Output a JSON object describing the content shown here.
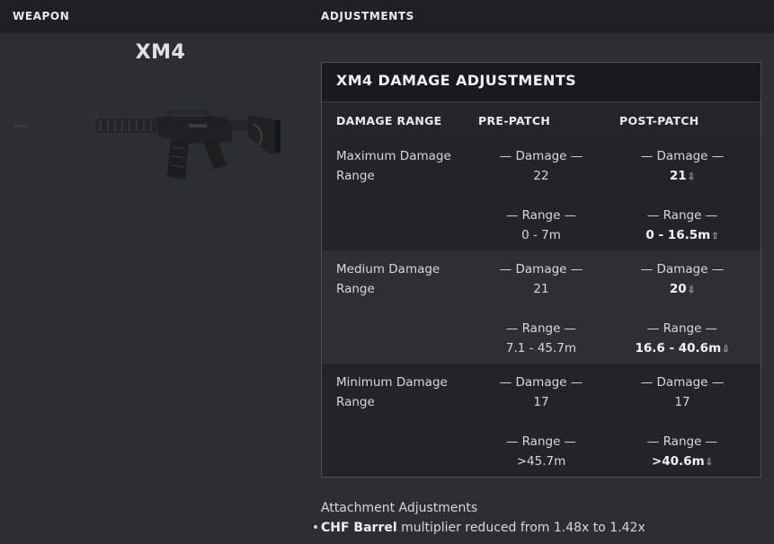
{
  "header": {
    "weapon_label": "WEAPON",
    "adjustments_label": "ADJUSTMENTS"
  },
  "weapon": {
    "name": "XM4",
    "image_icon": "assault-rifle-icon"
  },
  "panel": {
    "title": "XM4 DAMAGE ADJUSTMENTS",
    "columns": [
      "DAMAGE RANGE",
      "PRE-PATCH",
      "POST-PATCH"
    ],
    "damage_caption": "— Damage —",
    "range_caption": "— Range —",
    "rows": [
      {
        "label": "Maximum Damage Range",
        "pre_damage": "22",
        "pre_range": "0 - 7m",
        "post_damage": "21",
        "post_damage_arrow": "⇩",
        "post_range": "0 - 16.5m",
        "post_range_arrow": "⇧"
      },
      {
        "label": "Medium Damage Range",
        "pre_damage": "21",
        "pre_range": "7.1 - 45.7m",
        "post_damage": "20",
        "post_damage_arrow": "⇩",
        "post_range": "16.6 - 40.6m",
        "post_range_arrow": "⇩"
      },
      {
        "label": "Minimum Damage Range",
        "pre_damage": "17",
        "pre_range": ">45.7m",
        "post_damage": "17",
        "post_damage_arrow": "",
        "post_range": ">40.6m",
        "post_range_arrow": "⇩"
      }
    ]
  },
  "attachments": {
    "title": "Attachment Adjustments",
    "items": [
      {
        "name": "CHF Barrel",
        "text": " multiplier reduced from 1.48x to 1.42x"
      }
    ]
  },
  "colors": {
    "background": "#2b2f33",
    "topbar": "#1d2125",
    "panel_title_bg": "#181b1e",
    "row_dark": "#212528"
  }
}
